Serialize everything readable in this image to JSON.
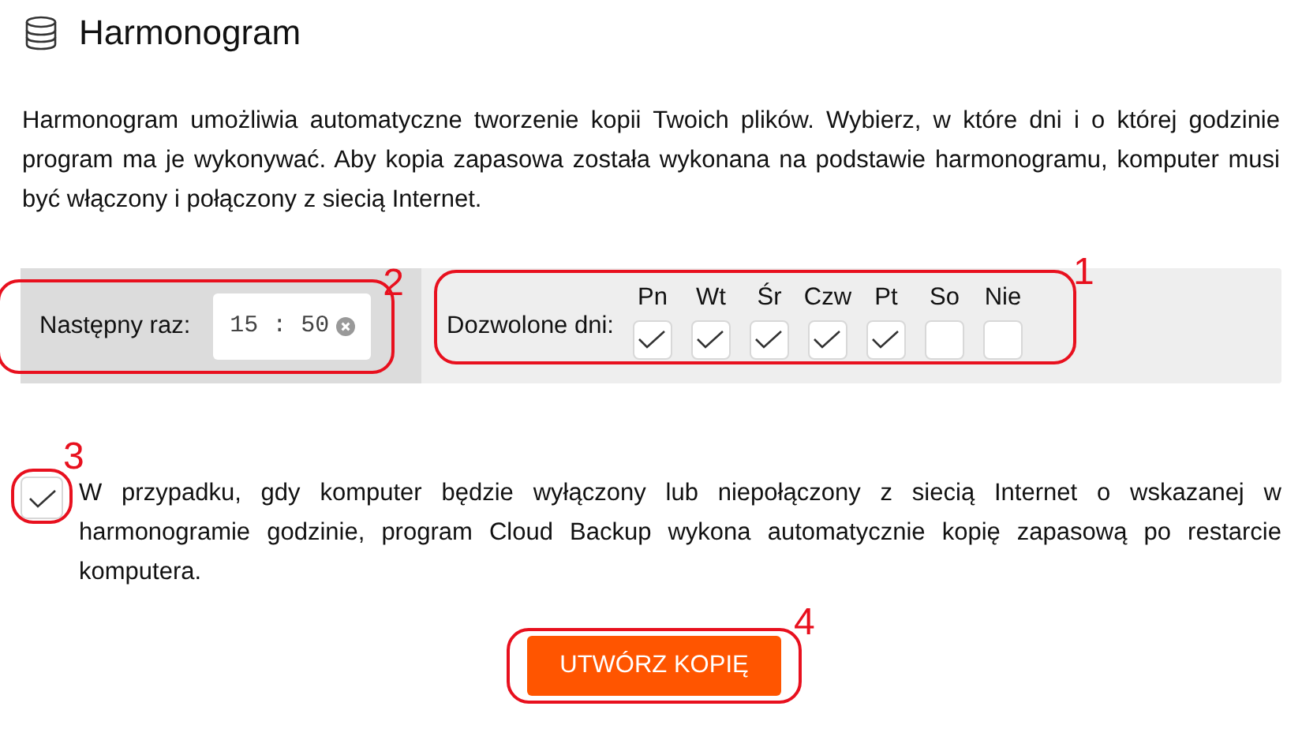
{
  "title": "Harmonogram",
  "description": "Harmonogram umożliwia automatyczne tworzenie kopii Twoich plików. Wybierz, w które dni i o której godzinie program ma je wykonywać. Aby kopia zapasowa została wykonana na podstawie harmonogramu, komputer musi być włączony i połączony z siecią Internet.",
  "next_time": {
    "label": "Następny raz:",
    "value": "15 : 50",
    "annotation": "2"
  },
  "allowed_days": {
    "label": "Dozwolone dni:",
    "annotation": "1",
    "days": [
      {
        "label": "Pn",
        "checked": true
      },
      {
        "label": "Wt",
        "checked": true
      },
      {
        "label": "Śr",
        "checked": true
      },
      {
        "label": "Czw",
        "checked": true
      },
      {
        "label": "Pt",
        "checked": true
      },
      {
        "label": "So",
        "checked": false
      },
      {
        "label": "Nie",
        "checked": false
      }
    ]
  },
  "catch_up": {
    "checked": true,
    "annotation": "3",
    "text": "W przypadku, gdy komputer będzie wyłączony lub niepołączony z siecią Internet o wskazanej w harmonogramie godzinie, program Cloud Backup wykona automatycznie kopię zapasową po restarcie komputera."
  },
  "button": {
    "label": "UTWÓRZ KOPIĘ",
    "annotation": "4"
  }
}
